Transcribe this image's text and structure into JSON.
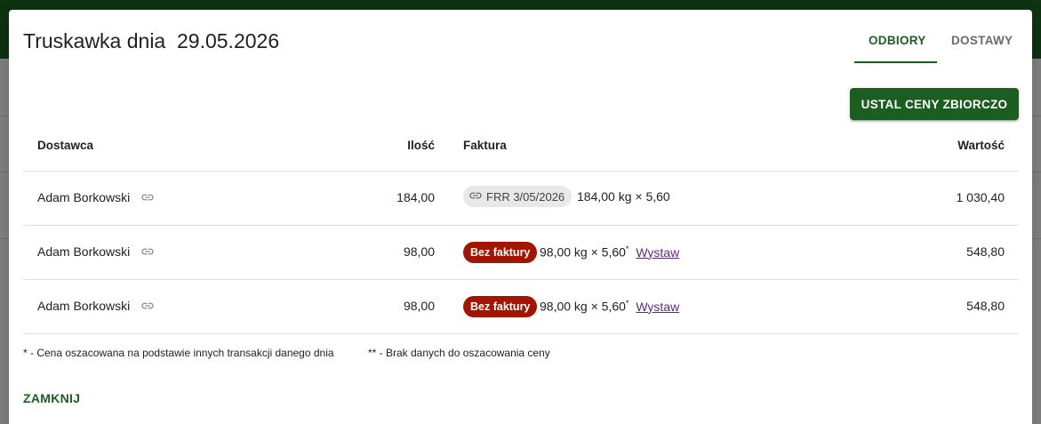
{
  "dialog": {
    "title": "Truskawka dnia  29.05.2026",
    "tabs": [
      {
        "label": "ODBIORY",
        "active": true
      },
      {
        "label": "DOSTAWY",
        "active": false
      }
    ],
    "bulk_price_button": "USTAL CENY ZBIORCZO",
    "close_button": "ZAMKNIJ"
  },
  "table": {
    "headers": {
      "supplier": "Dostawca",
      "quantity": "Ilość",
      "invoice": "Faktura",
      "value": "Wartość"
    },
    "rows": [
      {
        "supplier": "Adam Borkowski",
        "quantity": "184,00",
        "invoice_chip": "FRR 3/05/2026",
        "invoice_detail": "184,00 kg × 5,60",
        "estimate_mark": "",
        "action": "",
        "value": "1 030,40"
      },
      {
        "supplier": "Adam Borkowski",
        "quantity": "98,00",
        "invoice_badge": "Bez faktury",
        "invoice_detail": "98,00 kg × 5,60",
        "estimate_mark": "*",
        "action": "Wystaw",
        "value": "548,80"
      },
      {
        "supplier": "Adam Borkowski",
        "quantity": "98,00",
        "invoice_badge": "Bez faktury",
        "invoice_detail": "98,00 kg × 5,60",
        "estimate_mark": "*",
        "action": "Wystaw",
        "value": "548,80"
      }
    ]
  },
  "footnotes": {
    "estimated": "* - Cena oszacowana na podstawie innych transakcji danego dnia",
    "no_data": "** - Brak danych do oszacowania ceny"
  },
  "colors": {
    "primary": "#1b5e20",
    "badge_red": "#a31500",
    "link": "#5e2d7e"
  },
  "icons": {
    "link": "link-icon"
  }
}
